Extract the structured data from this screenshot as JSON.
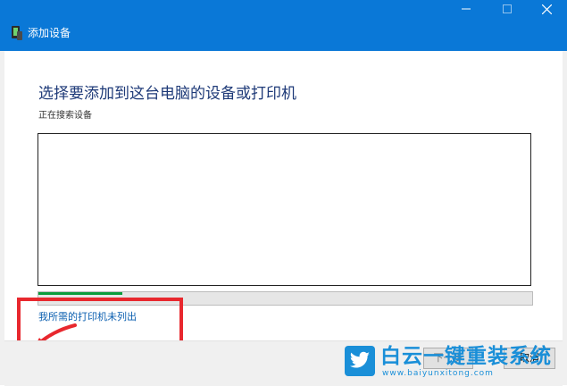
{
  "window": {
    "title": "添加设备",
    "controls": {
      "minimize": "minimize",
      "maximize": "maximize",
      "close": "close"
    }
  },
  "main": {
    "heading": "选择要添加到这台电脑的设备或打印机",
    "status": "正在搜索设备",
    "progress_fraction": 0.17,
    "printer_not_listed_link": "我所需的打印机未列出"
  },
  "footer": {
    "next_label": "下一步",
    "cancel_label": "取消"
  },
  "watermark": {
    "title": "白云一键重装系统",
    "url": "www.baiyunxitong.com"
  },
  "colors": {
    "titlebar": "#0a78d7",
    "heading": "#1e3a78",
    "link": "#0b5fb0",
    "progress_fill": "#0b9c3c",
    "highlight": "#e8282e",
    "watermark": "#1a8fd8"
  },
  "icons": {
    "app": "devices-icon",
    "annotation": "red-arrow-icon",
    "brand": "twitter-bird-icon"
  }
}
